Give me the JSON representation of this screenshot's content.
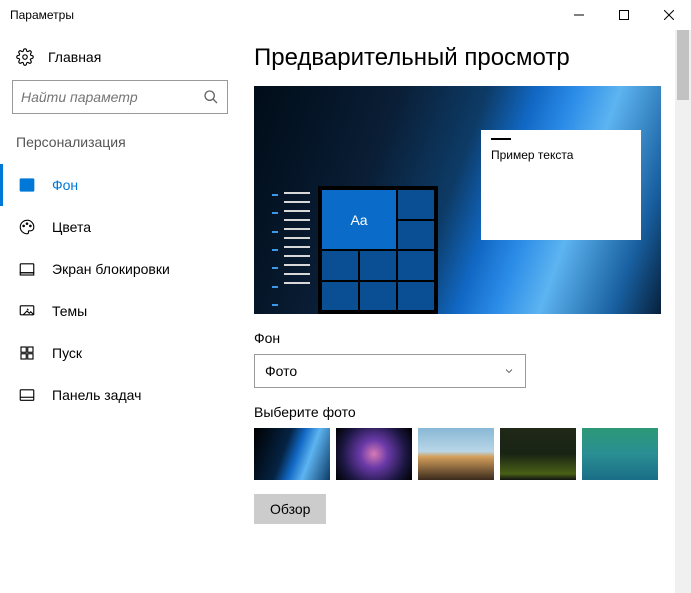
{
  "window": {
    "title": "Параметры"
  },
  "sidebar": {
    "home": "Главная",
    "search_placeholder": "Найти параметр",
    "section": "Персонализация",
    "items": [
      {
        "label": "Фон"
      },
      {
        "label": "Цвета"
      },
      {
        "label": "Экран блокировки"
      },
      {
        "label": "Темы"
      },
      {
        "label": "Пуск"
      },
      {
        "label": "Панель задач"
      }
    ]
  },
  "main": {
    "title": "Предварительный просмотр",
    "preview_tile_text": "Aa",
    "preview_sample_text": "Пример текста",
    "background_label": "Фон",
    "background_selected": "Фото",
    "choose_label": "Выберите фото",
    "browse": "Обзор"
  }
}
